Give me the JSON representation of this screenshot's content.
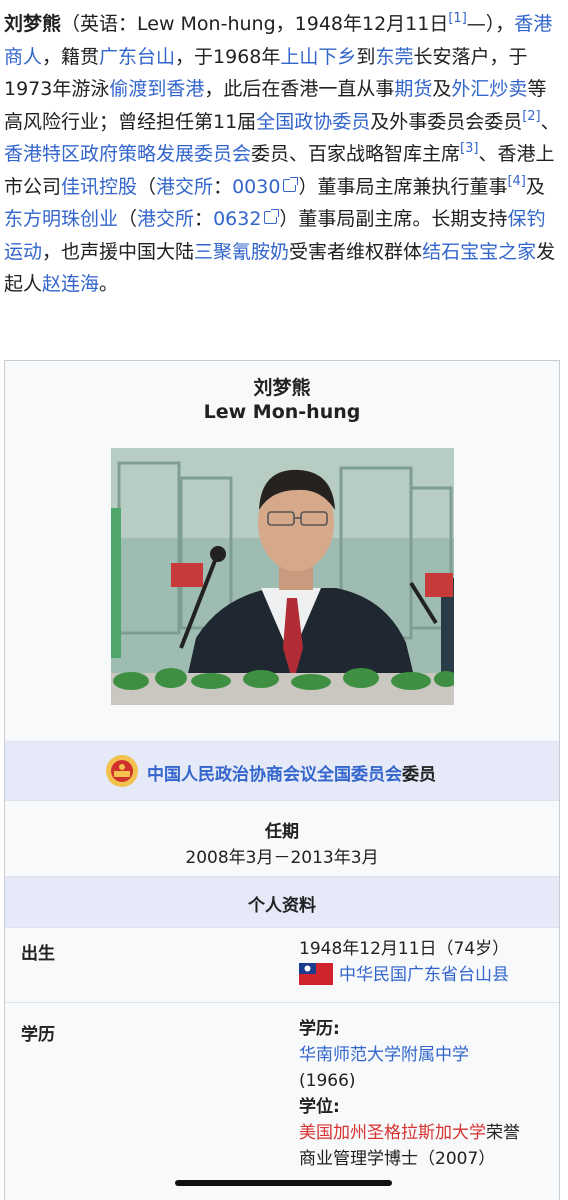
{
  "intro": {
    "name": "刘梦熊",
    "t1": "（英语：Lew Mon-hung，1948年12月11日",
    "ref1": "[1]",
    "t2": "—），",
    "link_hk_merchant": "香港商人",
    "t3": "，籍贯",
    "link_taishan": "广东台山",
    "t4": "，于1968年",
    "link_xiaxiang": "上山下乡",
    "t5": "到",
    "link_dongguan": "东莞",
    "t6": "长安落户，于1973年游泳",
    "link_toudu": "偷渡到香港",
    "t7": "，此后在香港一直从事",
    "link_futures": "期货",
    "t8": "及",
    "link_forex": "外汇炒卖",
    "t9": "等高风险行业；曾经担任第11届",
    "link_cppcc_member": "全国政协委员",
    "t10": "及外事委员会委员",
    "ref2": "[2]",
    "t11": "、",
    "link_cpu": "香港特区政府策略发展委员会",
    "t12": "委员、百家战略智库主席",
    "ref3": "[3]",
    "t13": "、香港上市公司",
    "link_jiaxun": "佳讯控股",
    "t14": "（",
    "link_hkex1": "港交所",
    "t15": "：",
    "stock1": "0030",
    "t16": "）董事局主席兼执行董事",
    "ref4": "[4]",
    "t17": "及",
    "link_pearl": "东方明珠创业",
    "t18": "（",
    "link_hkex2": "港交所",
    "t19": "：",
    "stock2": "0632",
    "t20": "）董事局副主席。长期支持",
    "link_baodiao": "保钓运动",
    "t21": "，也声援中国大陆",
    "link_melamine": "三聚氰胺奶",
    "t22": "受害者维权群体",
    "link_jieshi": "结石宝宝之家",
    "t23": "发起人",
    "link_zhao": "赵连海",
    "t24": "。"
  },
  "infobox": {
    "title_zh": "刘梦熊",
    "title_en": "Lew Mon-hung",
    "office_link": "中国人民政治协商会议全国委员会",
    "office_suffix": "委员",
    "term_label": "任期",
    "term_value": "2008年3月－2013年3月",
    "personal_header": "个人资料",
    "birth_label": "出生",
    "birth_date": "1948年12月11日（74岁）",
    "birth_place": "中华民国广东省台山县",
    "edu_label": "学历",
    "edu_sub1": "学历",
    "edu_school": "华南师范大学附属中学",
    "edu_school_year": "(1966)",
    "edu_sub2": "学位",
    "edu_country": "美国",
    "edu_univ": "加州圣格拉斯加大学",
    "edu_degree_a": "荣誉",
    "edu_degree_b": "商业管理学博士（2007）"
  },
  "colors": {
    "link": "#3366cc",
    "redlink": "#d73333",
    "band": "#e6e9f7"
  }
}
